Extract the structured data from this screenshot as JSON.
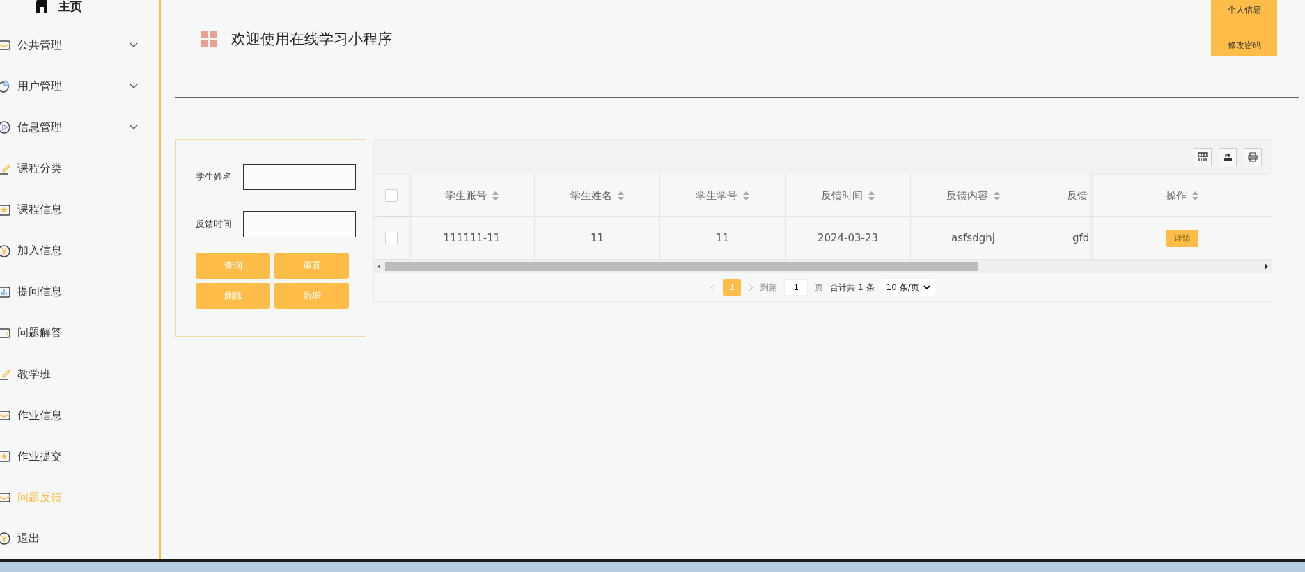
{
  "sidebar": {
    "home": {
      "label": "主页"
    },
    "items": [
      {
        "label": "公共管理",
        "kind": "group",
        "selected": false
      },
      {
        "label": "用户管理",
        "kind": "group",
        "selected": false
      },
      {
        "label": "信息管理",
        "kind": "group",
        "selected": false
      },
      {
        "label": "课程分类",
        "kind": "link",
        "selected": false
      },
      {
        "label": "课程信息",
        "kind": "link",
        "selected": false
      },
      {
        "label": "加入信息",
        "kind": "link",
        "selected": false
      },
      {
        "label": "提问信息",
        "kind": "link",
        "selected": false
      },
      {
        "label": "问题解答",
        "kind": "link",
        "selected": false
      },
      {
        "label": "教学班",
        "kind": "link",
        "selected": false
      },
      {
        "label": "作业信息",
        "kind": "link",
        "selected": false
      },
      {
        "label": "作业提交",
        "kind": "link",
        "selected": false
      },
      {
        "label": "问题反馈",
        "kind": "link",
        "selected": true
      },
      {
        "label": "退出",
        "kind": "link",
        "selected": false
      }
    ]
  },
  "header": {
    "title": "欢迎使用在线学习小程序",
    "user_menu": [
      "个人信息",
      "修改密码"
    ]
  },
  "search": {
    "fields": [
      {
        "label": "学生姓名"
      },
      {
        "label": "反馈时间"
      }
    ],
    "buttons": [
      "查询",
      "重置",
      "删除",
      "新增"
    ]
  },
  "table": {
    "select_all_checked": false,
    "columns": [
      "学生账号",
      "学生姓名",
      "学生学号",
      "反馈时间",
      "反馈内容",
      "反馈"
    ],
    "action_column": "操作",
    "rows": [
      {
        "checked": false,
        "cells": [
          "111111-11",
          "11",
          "11",
          "2024-03-23",
          "asfsdghj",
          "gfd"
        ],
        "action": "详情"
      }
    ]
  },
  "pagination": {
    "pages": [
      {
        "label": "1",
        "selected": true
      }
    ],
    "goto_prefix": "到第",
    "goto_value": "1",
    "goto_suffix": "页",
    "total": "合计共 1 条",
    "page_size": "10 条/页"
  }
}
